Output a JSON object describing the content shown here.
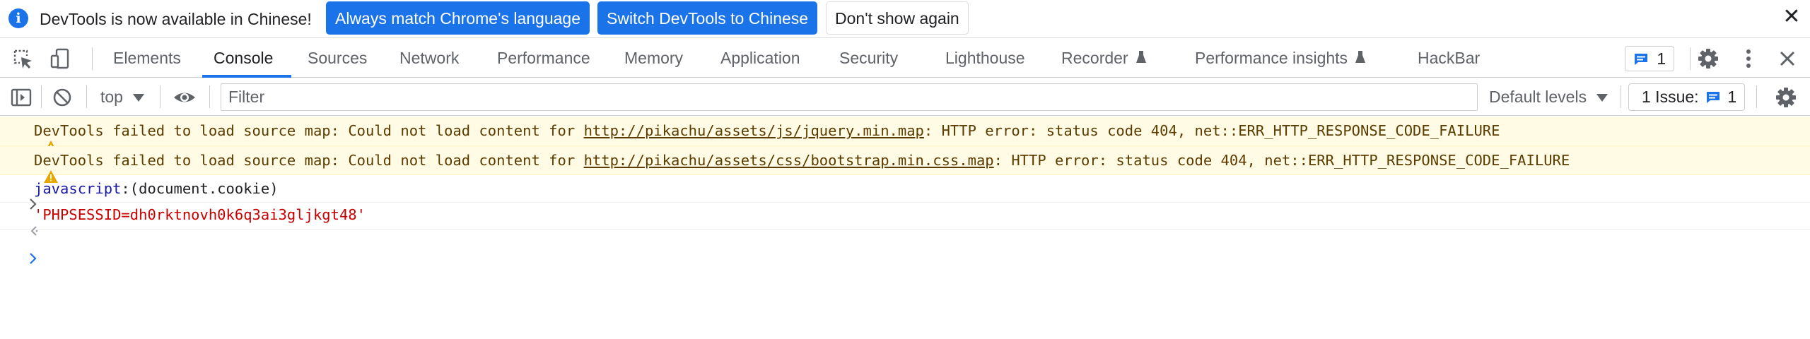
{
  "infobar": {
    "message": "DevTools is now available in Chinese!",
    "match_language_button": "Always match Chrome's language",
    "switch_button": "Switch DevTools to Chinese",
    "dismiss_button": "Don't show again",
    "close_symbol": "✕"
  },
  "tabs": [
    {
      "label": "Elements"
    },
    {
      "label": "Console"
    },
    {
      "label": "Sources"
    },
    {
      "label": "Network"
    },
    {
      "label": "Performance"
    },
    {
      "label": "Memory"
    },
    {
      "label": "Application"
    },
    {
      "label": "Security"
    },
    {
      "label": "Lighthouse"
    },
    {
      "label": "Recorder"
    },
    {
      "label": "Performance insights"
    },
    {
      "label": "HackBar"
    }
  ],
  "active_tab": "Console",
  "toolbar_right": {
    "messages_count": "1"
  },
  "console_toolbar": {
    "context": "top",
    "filter_placeholder": "Filter",
    "levels": "Default levels",
    "issues_label": "1 Issue:",
    "issues_count": "1"
  },
  "messages": [
    {
      "type": "warning",
      "prefix": "DevTools failed to load source map: Could not load content for ",
      "link": "http://pikachu/assets/js/jquery.min.map",
      "suffix": ": HTTP error: status code 404, net::ERR_HTTP_RESPONSE_CODE_FAILURE"
    },
    {
      "type": "warning",
      "prefix": "DevTools failed to load source map: Could not load content for ",
      "link": "http://pikachu/assets/css/bootstrap.min.css.map",
      "suffix": ": HTTP error: status code 404, net::ERR_HTTP_RESPONSE_CODE_FAILURE"
    }
  ],
  "command": {
    "keyword": "javascript",
    "rest": ":(document.cookie)"
  },
  "result": "'PHPSESSID=dh0rktnovh0k6q3ai3gljkgt48'",
  "colors": {
    "accent": "#1a73e8",
    "warning_bg": "#fffbe5",
    "warning_text": "#5c3c00",
    "string": "#c80000"
  }
}
